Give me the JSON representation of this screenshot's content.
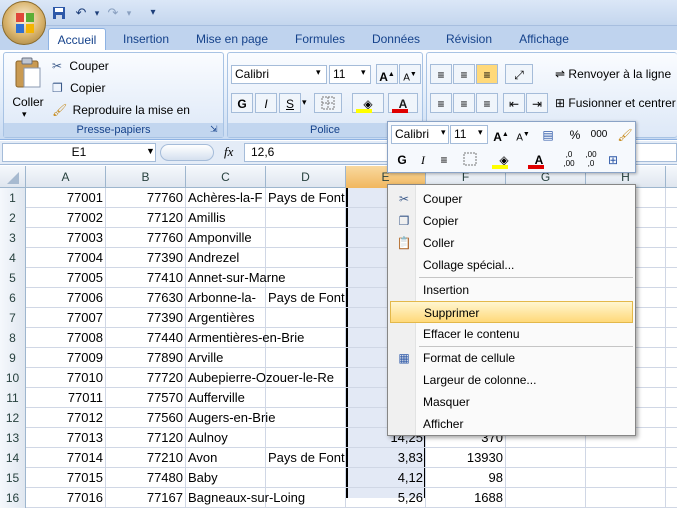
{
  "qat": {
    "undo_icon": "undo-icon",
    "redo_icon": "redo-icon"
  },
  "tabs": [
    "Accueil",
    "Insertion",
    "Mise en page",
    "Formules",
    "Données",
    "Révision",
    "Affichage"
  ],
  "clipboard": {
    "paste": "Coller",
    "cut": "Couper",
    "copy": "Copier",
    "format_painter": "Reproduire la mise en forme",
    "label": "Presse-papiers"
  },
  "font": {
    "name": "Calibri",
    "size": "11",
    "label": "Police",
    "bold": "G",
    "italic": "I",
    "underline": "S",
    "font_color": "A",
    "grow": "A",
    "shrink": "A"
  },
  "alignment": {
    "wrap": "Renvoyer à la ligne",
    "merge": "Fusionner et centrer"
  },
  "formula": {
    "namebox": "E1",
    "fx": "fx",
    "value": "12,6"
  },
  "columns": [
    "A",
    "B",
    "C",
    "D",
    "E",
    "F",
    "G",
    "H"
  ],
  "rows": [
    {
      "n": "1",
      "a": "77001",
      "b": "77760",
      "c": "Achères-la-F",
      "d": "Pays de Font",
      "e": "",
      "f": ""
    },
    {
      "n": "2",
      "a": "77002",
      "b": "77120",
      "c": "Amillis",
      "d": "",
      "e": "",
      "f": ""
    },
    {
      "n": "3",
      "a": "77003",
      "b": "77760",
      "c": "Amponville",
      "d": "",
      "e": "",
      "f": ""
    },
    {
      "n": "4",
      "a": "77004",
      "b": "77390",
      "c": "Andrezel",
      "d": "",
      "e": "",
      "f": ""
    },
    {
      "n": "5",
      "a": "77005",
      "b": "77410",
      "c": "Annet-sur-Marne",
      "d": "",
      "e": "",
      "f": ""
    },
    {
      "n": "6",
      "a": "77006",
      "b": "77630",
      "c": "Arbonne-la-",
      "d": "Pays de Font",
      "e": "",
      "f": ""
    },
    {
      "n": "7",
      "a": "77007",
      "b": "77390",
      "c": "Argentières",
      "d": "",
      "e": "",
      "f": ""
    },
    {
      "n": "8",
      "a": "77008",
      "b": "77440",
      "c": "Armentières-en-Brie",
      "d": "",
      "e": "",
      "f": ""
    },
    {
      "n": "9",
      "a": "77009",
      "b": "77890",
      "c": "Arville",
      "d": "",
      "e": "",
      "f": ""
    },
    {
      "n": "10",
      "a": "77010",
      "b": "77720",
      "c": "Aubepierre-Ozouer-le-Re",
      "d": "",
      "e": "",
      "f": ""
    },
    {
      "n": "11",
      "a": "77011",
      "b": "77570",
      "c": "Aufferville",
      "d": "",
      "e": "",
      "f": ""
    },
    {
      "n": "12",
      "a": "77012",
      "b": "77560",
      "c": "Augers-en-Brie",
      "d": "",
      "e": "",
      "f": ""
    },
    {
      "n": "13",
      "a": "77013",
      "b": "77120",
      "c": "Aulnoy",
      "d": "",
      "e": "14,25",
      "f": "370"
    },
    {
      "n": "14",
      "a": "77014",
      "b": "77210",
      "c": "Avon",
      "d": "Pays de Font",
      "e": "3,83",
      "f": "13930"
    },
    {
      "n": "15",
      "a": "77015",
      "b": "77480",
      "c": "Baby",
      "d": "",
      "e": "4,12",
      "f": "98"
    },
    {
      "n": "16",
      "a": "77016",
      "b": "77167",
      "c": "Bagneaux-sur-Loing",
      "d": "",
      "e": "5,26",
      "f": "1688"
    }
  ],
  "minitoolbar": {
    "font": "Calibri",
    "size": "11",
    "bold": "G",
    "italic": "I",
    "percent": "%",
    "thousands": "000",
    "inc_dec": ",0\n,00",
    "dec_dec": ",00\n,0"
  },
  "context_menu": {
    "cut": "Couper",
    "copy": "Copier",
    "paste": "Coller",
    "paste_special": "Collage spécial...",
    "insert": "Insertion",
    "delete": "Supprimer",
    "clear": "Effacer le contenu",
    "format_cells": "Format de cellule",
    "col_width": "Largeur de colonne...",
    "hide": "Masquer",
    "unhide": "Afficher"
  },
  "colors": {
    "accent": "#15428b",
    "ribbon": "#dfe9f5",
    "highlight": "#ffd97a",
    "font_red": "#e00000",
    "fill_yellow": "#ffff00"
  }
}
